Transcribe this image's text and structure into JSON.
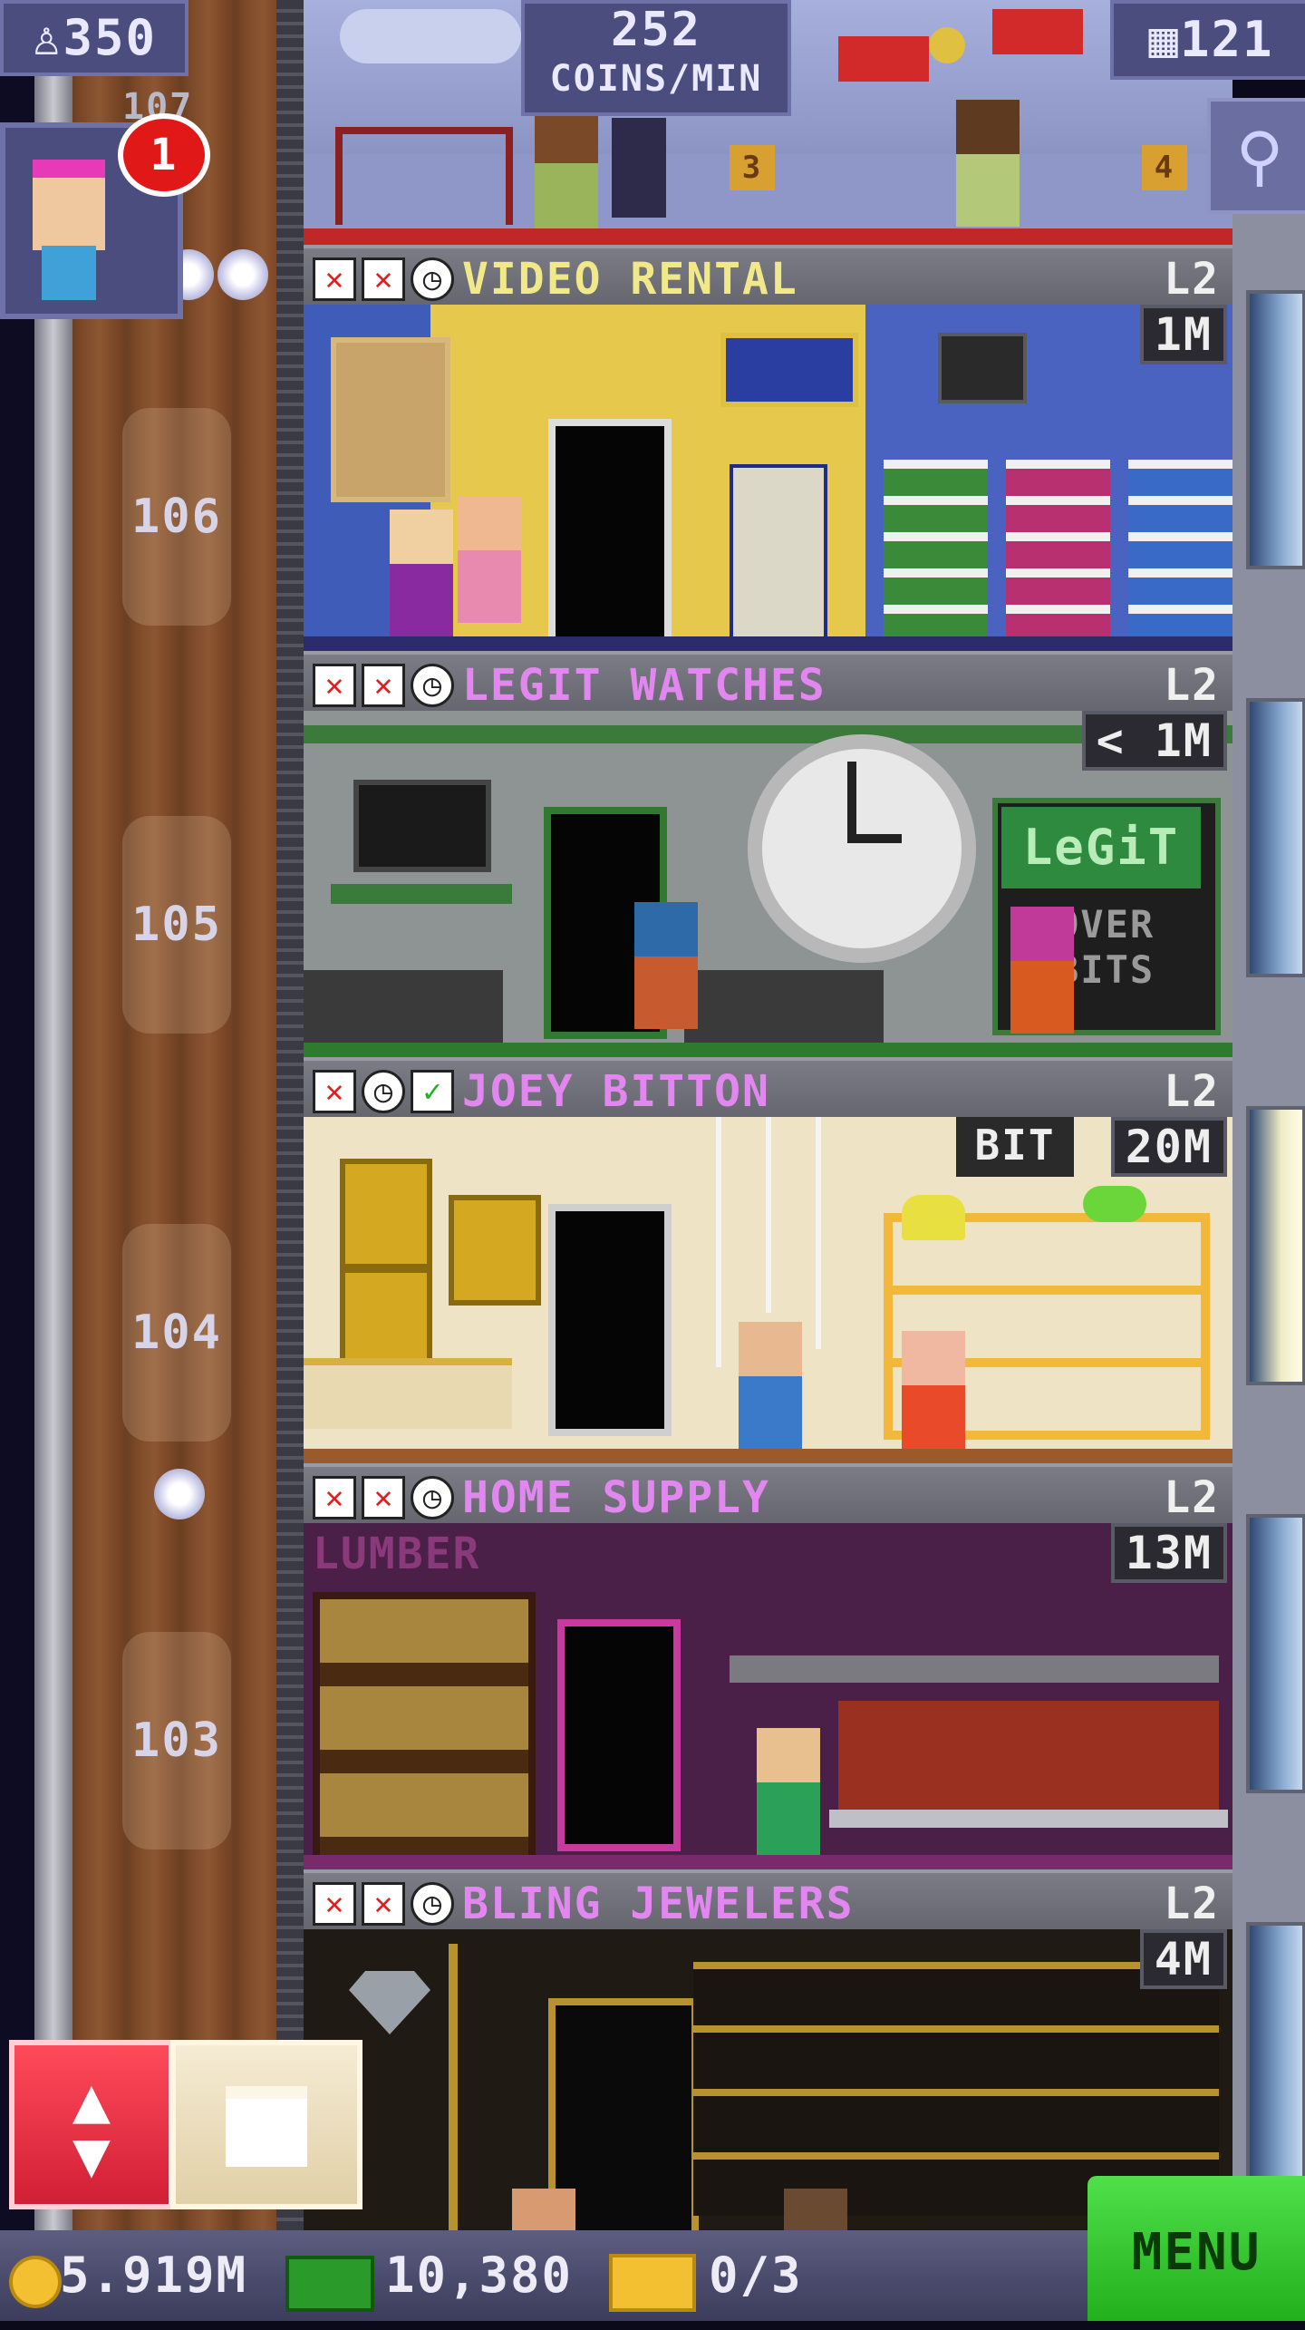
{
  "hud": {
    "population": "350",
    "coins_rate_value": "252",
    "coins_rate_unit": "COINS/MIN",
    "floors_count": "121",
    "notification_count": "1",
    "partial_floor_label": "107"
  },
  "elevator": {
    "floor_numbers": [
      "106",
      "105",
      "104",
      "103"
    ]
  },
  "floors": [
    {
      "name": "VIDEO RENTAL",
      "level": "L2",
      "cost": "1M",
      "status_icons": [
        "x",
        "x",
        "clock"
      ],
      "name_color": "#f0e889"
    },
    {
      "name": "LEGIT WATCHES",
      "level": "L2",
      "cost": "< 1M",
      "status_icons": [
        "x",
        "x",
        "clock"
      ],
      "name_color": "#e287f0"
    },
    {
      "name": "JOEY BITTON",
      "level": "L2",
      "cost": "20M",
      "status_icons": [
        "x",
        "clock",
        "check"
      ],
      "name_color": "#e287f0"
    },
    {
      "name": "HOME SUPPLY",
      "level": "L2",
      "cost": "13M",
      "status_icons": [
        "x",
        "x",
        "clock"
      ],
      "name_color": "#e287f0"
    },
    {
      "name": "BLING JEWELERS",
      "level": "L2",
      "cost": "4M",
      "status_icons": [
        "x",
        "x",
        "clock"
      ],
      "name_color": "#e287f0"
    }
  ],
  "scene_text": {
    "legit_sign": "LeGiT",
    "legit_sign2": "OVER",
    "legit_sign3": "BITS",
    "joey_sign": "BIT",
    "lumber_sign": "LUMBER",
    "top_sign_left": "3",
    "top_sign_right": "4"
  },
  "bottom_bar": {
    "coins": "5.919M",
    "bux": "10,380",
    "tickets": "0/3",
    "menu_label": "MENU"
  },
  "colors": {
    "accent_menu": "#36c82f",
    "elevator_button": "#e0283c",
    "floor_name_default": "#e287f0",
    "floor_name_highlight": "#f0e889",
    "badge_red": "#e01818"
  }
}
